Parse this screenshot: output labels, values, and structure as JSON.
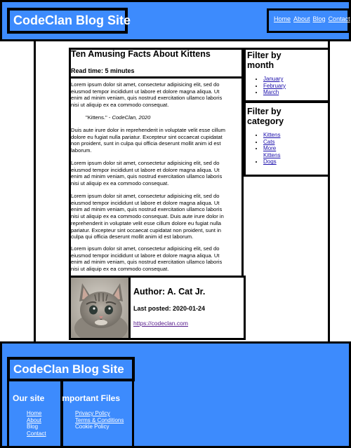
{
  "header": {
    "site_title": "CodeClan Blog Site",
    "nav": [
      "Home",
      "About",
      "Blog",
      "Contact"
    ]
  },
  "article": {
    "title": "Ten Amusing Facts About Kittens",
    "read_time": "Read time: 5 minutes",
    "paragraphs": [
      [
        "Lorem ipsum dolor sit amet, consectetur adipisicing elit, sed do",
        "eiusmod tempor incididunt ut labore et dolore magna aliqua. Ut",
        "enim ad minim veniam, quis nostrud exercitation ullamco laboris",
        "nisi ut aliquip ex ea commodo consequat."
      ],
      [
        "Duis aute irure dolor in reprehenderit in voluptate velit esse cillum",
        "dolore eu fugiat nulla pariatur. Excepteur sint occaecat cupidatat",
        "non proident, sunt in culpa qui officia deserunt mollit anim id est",
        "laborum."
      ],
      [
        "Lorem ipsum dolor sit amet, consectetur adipisicing elit, sed do",
        "eiusmod tempor incididunt ut labore et dolore magna aliqua. Ut",
        "enim ad minim veniam, quis nostrud exercitation ullamco laboris",
        "nisi ut aliquip ex ea commodo consequat."
      ],
      [
        "Lorem ipsum dolor sit amet, consectetur adipisicing elit, sed do",
        "eiusmod tempor incididunt ut labore et dolore magna aliqua. Ut",
        "enim ad minim veniam, quis nostrud exercitation ullamco laboris",
        "nisi ut aliquip ex ea commodo consequat. Duis aute irure dolor in",
        "reprehenderit in voluptate velit esse cillum dolore eu fugiat nulla",
        "pariatur. Excepteur sint occaecat cupidatat non proident, sunt in",
        "culpa qui officia deserunt mollit anim id est laborum."
      ],
      [
        "Lorem ipsum dolor sit amet, consectetur adipisicing elit, sed do",
        "eiusmod tempor incididunt ut labore et dolore magna aliqua. Ut",
        "enim ad minim veniam, quis nostrud exercitation ullamco laboris",
        "nisi ut aliquip ex ea commodo consequat."
      ]
    ],
    "quote_text": "\"Kittens.\" - ",
    "quote_source": "CodeClan, 2020"
  },
  "author": {
    "name": "Author: A. Cat Jr.",
    "last_posted": "Last posted: 2020-01-24",
    "link": "https://codeclan.com"
  },
  "sidebar": {
    "month_title_line1": "Filter by",
    "month_title_line2": "month",
    "months": [
      "January",
      "February",
      "March"
    ],
    "category_title_line1": "Filter by",
    "category_title_line2": "category",
    "categories": [
      "Kittens",
      "Cats",
      "More",
      "Kittens",
      "Dogs"
    ]
  },
  "footer": {
    "site_title": "CodeClan Blog Site",
    "our_site_heading": "Our site",
    "our_site_links": [
      "Home",
      "About",
      "Blog",
      "Contact"
    ],
    "files_heading": "Important Files",
    "files_links": [
      "Privacy Policy",
      "Terms & Conditions",
      "Cookie Policy"
    ]
  },
  "colors": {
    "brand_blue": "#3d8bfd",
    "border": "#000000",
    "link_visited": "#551a8b"
  }
}
